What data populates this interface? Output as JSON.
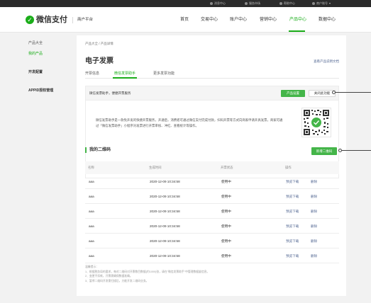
{
  "topbar": {
    "items": [
      "消息中心",
      "服务市场",
      "帮助中心",
      "商户账号"
    ]
  },
  "header": {
    "logo_text": "微信支付",
    "platform": "商户平台",
    "nav": [
      "首页",
      "交易中心",
      "账户中心",
      "营销中心",
      "产品中心",
      "数据中心"
    ],
    "active_nav": "产品中心"
  },
  "sidebar": {
    "group_title": "产品大全",
    "items": [
      "我的产品",
      "开发配置",
      "APPID授权管理"
    ],
    "active_item": "我的产品"
  },
  "main": {
    "breadcrumb": "产品大全 / 产品详情",
    "title": "电子发票",
    "help_link": "查看产品说明文档",
    "tabs": [
      "开票信息",
      "微信发票助手",
      "更多发票功能"
    ],
    "active_tab": "微信发票助手",
    "service_bar": {
      "text": "微信发票助手，便捷开票服务",
      "primary_button": "产品设置",
      "secondary_button": "关闭此功能"
    },
    "promo_text": "微信发票助手是一款免开发的快捷开票服务，开通后，消费者可通过微信支付完成付款，扫码开票等方式向商家申请开具发票，商家可通过「微信发票助手」小程序对发票进行开票审核、冲红、查看统计等操作。",
    "qr_label": "qr-code",
    "section_title": "我的二维码",
    "new_qr_button": "新增二维码",
    "table": {
      "headers": [
        "名称",
        "生成时间",
        "开票状态",
        "操作"
      ],
      "rows": [
        {
          "name": "aaa",
          "time": "2020-12-09 10:34:58",
          "status": "使用中",
          "action1": "预览下载",
          "action2": "删除"
        },
        {
          "name": "aaa",
          "time": "2020-12-09 10:34:58",
          "status": "使用中",
          "action1": "预览下载",
          "action2": "删除"
        },
        {
          "name": "aaa",
          "time": "2020-12-09 10:34:58",
          "status": "使用中",
          "action1": "预览下载",
          "action2": "删除"
        },
        {
          "name": "aaa",
          "time": "2020-12-09 10:34:58",
          "status": "使用中",
          "action1": "预览下载",
          "action2": "删除"
        },
        {
          "name": "aaa",
          "time": "2020-12-09 10:34:58",
          "status": "使用中",
          "action1": "预览下载",
          "action2": "删除"
        },
        {
          "name": "aaa",
          "time": "2020-12-09 10:34:58",
          "status": "使用中",
          "action1": "预览下载",
          "action2": "删除"
        }
      ]
    },
    "notes": [
      "温馨提示：",
      "1、根据税务局的要求，每对二维码对开票数目数据(约1000)张，请在\"微信发票助手\"中管理数据量信息。",
      "2、变更不扣款，开票需确保数据准确。",
      "3、暂停二维码开发需扫描后，方能开发二维码业务。"
    ]
  },
  "colors": {
    "accent": "#1aad19",
    "button_green": "#44b549",
    "link": "#576b95",
    "topbar": "#2b2b2b"
  }
}
